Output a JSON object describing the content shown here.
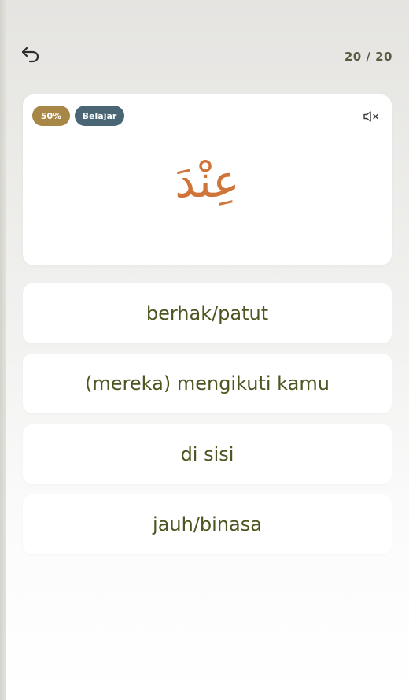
{
  "header": {
    "back_icon": "undo-arrow-icon",
    "progress_text": "20 / 20"
  },
  "card": {
    "percent_badge": "50%",
    "status_badge": "Belajar",
    "mute_icon": "speaker-muted-icon",
    "arabic_word": "عِنْدَ"
  },
  "options": [
    {
      "label": "berhak/patut"
    },
    {
      "label": "(mereka) mengikuti kamu"
    },
    {
      "label": "di sisi"
    },
    {
      "label": "jauh/binasa"
    }
  ],
  "colors": {
    "accent_gold": "#a88646",
    "badge_slate": "#4a6674",
    "arabic_orange": "#d0753a",
    "option_text": "#4d5620",
    "progress_text": "#5b5a42"
  }
}
